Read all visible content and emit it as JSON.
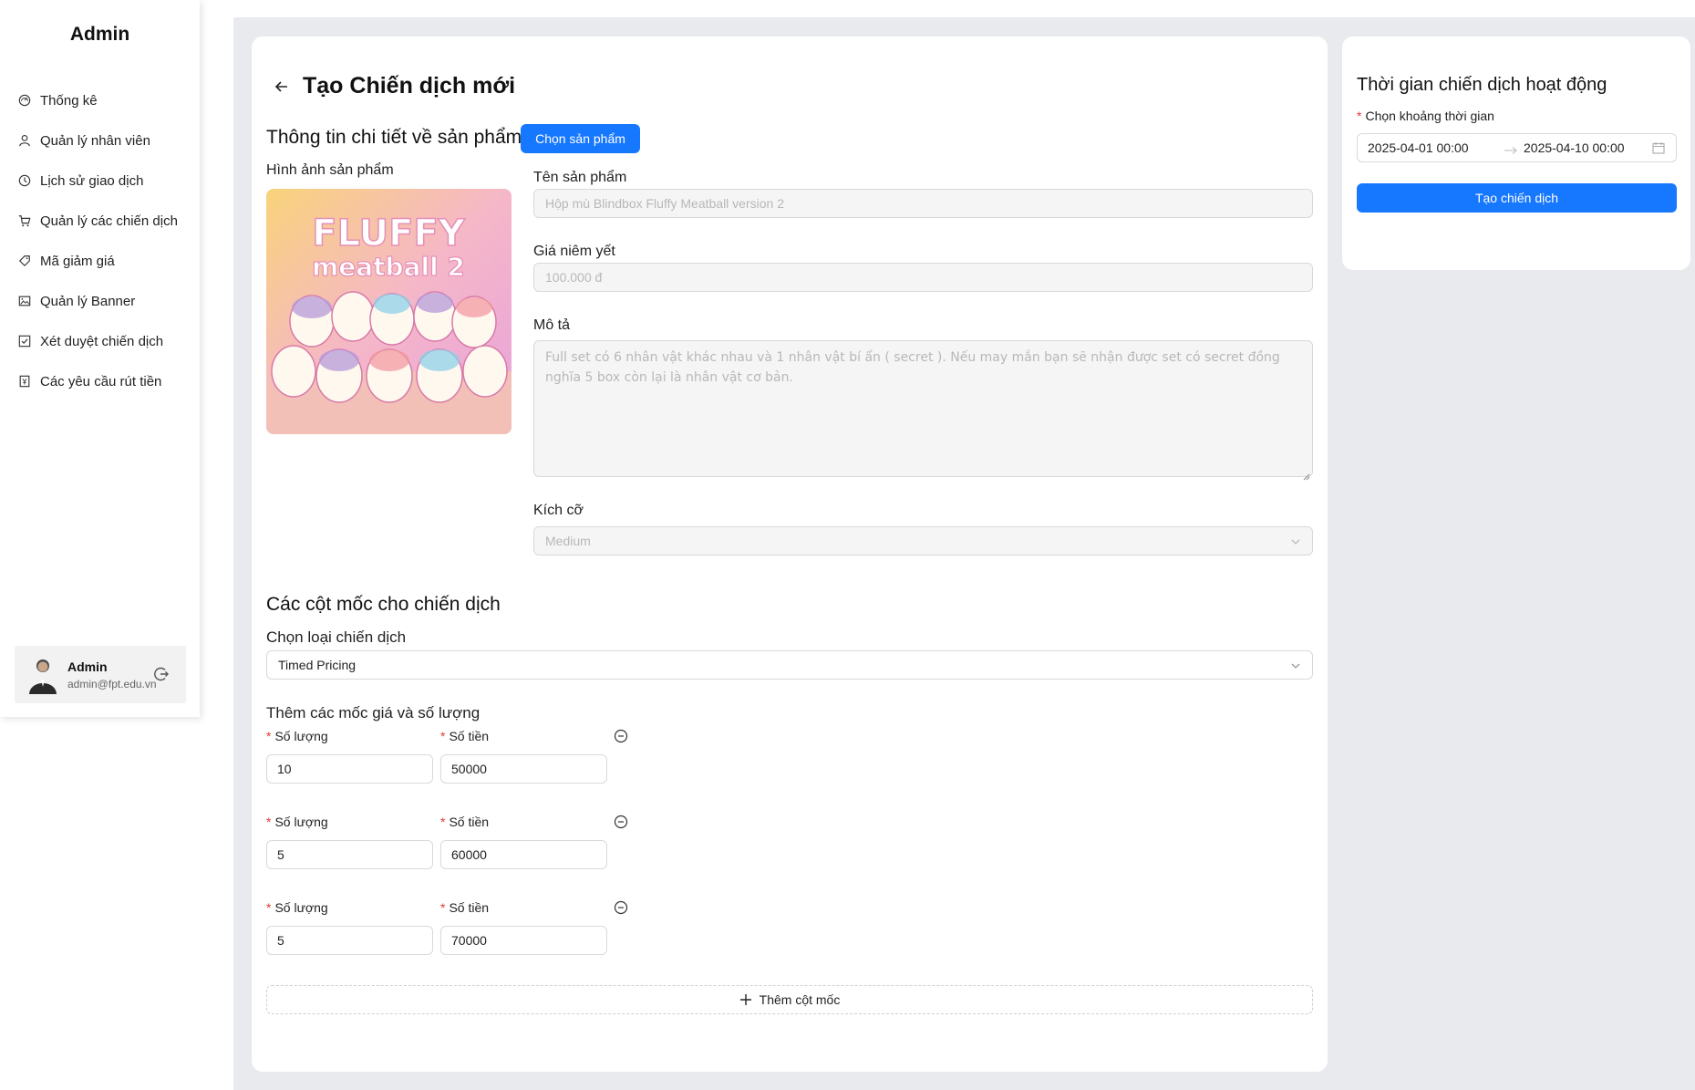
{
  "sidebar": {
    "brand": "Admin",
    "items": [
      {
        "label": "Thống kê",
        "icon": "dashboard-icon"
      },
      {
        "label": "Quản lý nhân viên",
        "icon": "user-icon"
      },
      {
        "label": "Lịch sử giao dịch",
        "icon": "history-icon"
      },
      {
        "label": "Quản lý các chiến dịch",
        "icon": "cart-icon"
      },
      {
        "label": "Mã giảm giá",
        "icon": "tag-icon"
      },
      {
        "label": "Quản lý Banner",
        "icon": "picture-icon"
      },
      {
        "label": "Xét duyệt chiến dịch",
        "icon": "check-square-icon"
      },
      {
        "label": "Các yêu cầu rút tiền",
        "icon": "withdraw-icon"
      }
    ],
    "user": {
      "name": "Admin",
      "email": "admin@fpt.edu.vn"
    }
  },
  "page": {
    "title": "Tạo Chiến dịch mới"
  },
  "product": {
    "section_title": "Thông tin chi tiết về sản phẩm",
    "choose_button": "Chọn sản phẩm",
    "image_label": "Hình ảnh sản phẩm",
    "image_text_line1": "FLUFFY",
    "image_text_line2": "meatball 2",
    "name_label": "Tên sản phẩm",
    "name_value": "Hộp mù Blindbox Fluffy Meatball version 2",
    "price_label": "Giá niêm yết",
    "price_value": "100.000 đ",
    "desc_label": "Mô tả",
    "desc_value": "Full set có 6 nhân vật khác nhau và 1 nhân vật bí ẩn ( secret ). Nếu may mắn bạn sẽ nhận được set có secret đồng nghĩa 5 box còn lại là nhân vật cơ bản.",
    "size_label": "Kích cỡ",
    "size_value": "Medium"
  },
  "milestones": {
    "section_title": "Các cột mốc cho chiến dịch",
    "type_label": "Chọn loại chiến dịch",
    "type_value": "Timed Pricing",
    "tiers_title": "Thêm các mốc giá và số lượng",
    "qty_label": "Số lượng",
    "amount_label": "Số tiền",
    "tiers": [
      {
        "qty": "10",
        "amount": "50000"
      },
      {
        "qty": "5",
        "amount": "60000"
      },
      {
        "qty": "5",
        "amount": "70000"
      }
    ],
    "add_button": "Thêm cột mốc"
  },
  "schedule": {
    "title": "Thời gian chiến dịch hoạt động",
    "range_label": "Chọn khoảng thời gian",
    "start": "2025-04-01 00:00",
    "end": "2025-04-10 00:00",
    "create_button": "Tạo chiến dịch"
  },
  "colors": {
    "primary": "#1677ff",
    "required": "#e53935",
    "page_bg": "#e9eaee"
  }
}
